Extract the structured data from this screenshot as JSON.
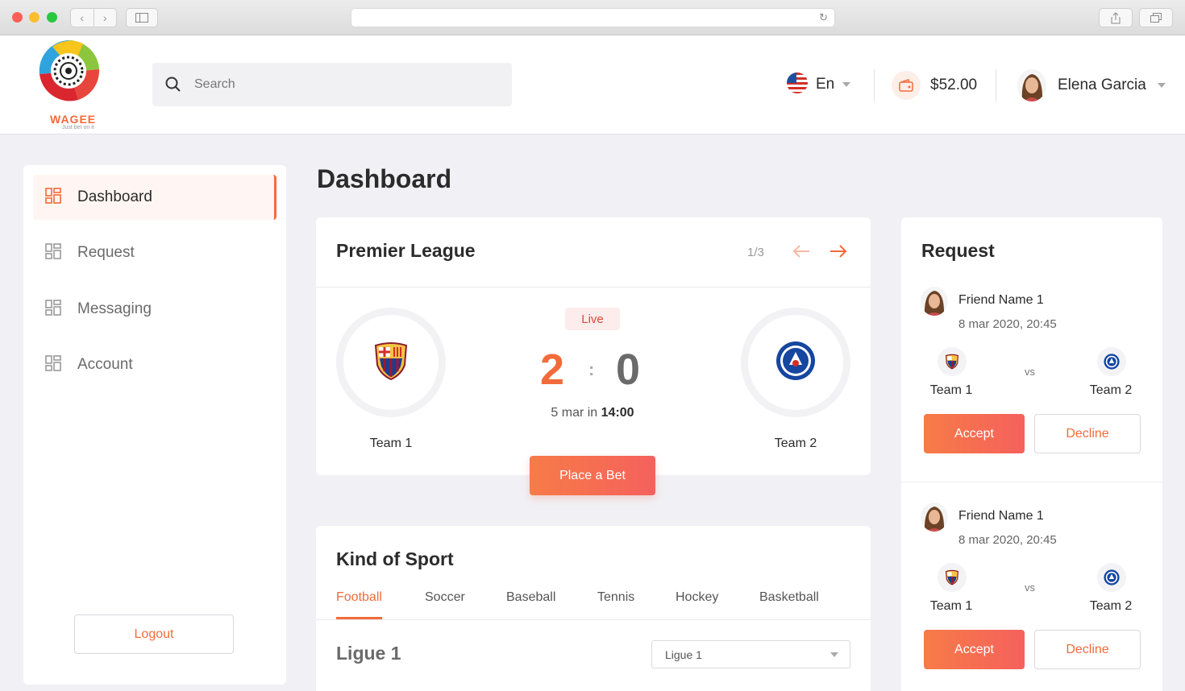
{
  "header": {
    "logo_text": "WAGEE",
    "logo_tagline": "Just bet on it",
    "search_placeholder": "Search",
    "language": "En",
    "balance": "$52.00",
    "user_name": "Elena Garcia"
  },
  "sidebar": {
    "items": [
      {
        "label": "Dashboard",
        "active": true
      },
      {
        "label": "Request",
        "active": false
      },
      {
        "label": "Messaging",
        "active": false
      },
      {
        "label": "Account",
        "active": false
      }
    ],
    "logout_label": "Logout"
  },
  "main": {
    "title": "Dashboard",
    "league": {
      "title": "Premier League",
      "pager": "1/3",
      "status": "Live",
      "home_team": "Team 1",
      "away_team": "Team 2",
      "home_score": "2",
      "score_separator": ":",
      "away_score": "0",
      "date_prefix": "5 mar in",
      "time": "14:00",
      "bet_label": "Place a Bet"
    },
    "sport": {
      "title": "Kind of Sport",
      "tabs": [
        "Football",
        "Soccer",
        "Baseball",
        "Tennis",
        "Hockey",
        "Basketball"
      ],
      "active_tab": "Football",
      "section_title": "Ligue 1",
      "select_value": "Ligue 1"
    }
  },
  "requests": {
    "title": "Request",
    "items": [
      {
        "friend": "Friend Name 1",
        "date": "8 mar 2020, 20:45",
        "team1": "Team 1",
        "team2": "Team 2",
        "vs": "vs",
        "accept": "Accept",
        "decline": "Decline"
      },
      {
        "friend": "Friend Name 1",
        "date": "8 mar 2020, 20:45",
        "team1": "Team 1",
        "team2": "Team 2",
        "vs": "vs",
        "accept": "Accept",
        "decline": "Decline"
      }
    ]
  },
  "colors": {
    "accent": "#f26b3a",
    "live_bg": "#fdecec",
    "live_text": "#e0473c",
    "background": "#f1f1f5"
  },
  "icons": {
    "search": "search-icon",
    "flag": "us-flag-icon",
    "wallet": "wallet-icon",
    "nav": "grid-icon",
    "prev": "arrow-left-icon",
    "next": "arrow-right-icon"
  }
}
